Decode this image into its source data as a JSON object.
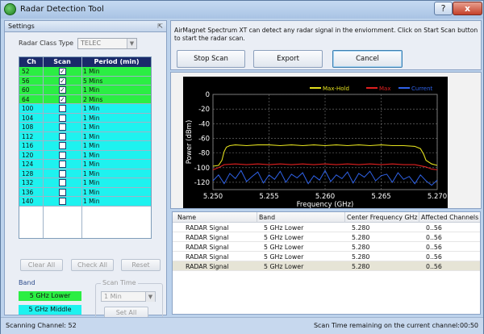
{
  "window": {
    "title": "Radar Detection Tool",
    "help_label": "?",
    "close_label": "x"
  },
  "settings": {
    "header": "Settings",
    "radar_class_label": "Radar Class Type",
    "radar_class_value": "TELEC",
    "table_headers": {
      "ch": "Ch",
      "scan": "Scan",
      "period": "Period (min)"
    },
    "channels": [
      {
        "ch": "52",
        "checked": true,
        "period": "1 Min",
        "band": "lower"
      },
      {
        "ch": "56",
        "checked": true,
        "period": "5 Mins",
        "band": "lower"
      },
      {
        "ch": "60",
        "checked": true,
        "period": "1 Min",
        "band": "lower"
      },
      {
        "ch": "64",
        "checked": true,
        "period": "2 Mins",
        "band": "lower"
      },
      {
        "ch": "100",
        "checked": false,
        "period": "1 Min",
        "band": "middle"
      },
      {
        "ch": "104",
        "checked": false,
        "period": "1 Min",
        "band": "middle"
      },
      {
        "ch": "108",
        "checked": false,
        "period": "1 Min",
        "band": "middle"
      },
      {
        "ch": "112",
        "checked": false,
        "period": "1 Min",
        "band": "middle"
      },
      {
        "ch": "116",
        "checked": false,
        "period": "1 Min",
        "band": "middle"
      },
      {
        "ch": "120",
        "checked": false,
        "period": "1 Min",
        "band": "middle"
      },
      {
        "ch": "124",
        "checked": false,
        "period": "1 Min",
        "band": "middle"
      },
      {
        "ch": "128",
        "checked": false,
        "period": "1 Min",
        "band": "middle"
      },
      {
        "ch": "132",
        "checked": false,
        "period": "1 Min",
        "band": "middle"
      },
      {
        "ch": "136",
        "checked": false,
        "period": "1 Min",
        "band": "middle"
      },
      {
        "ch": "140",
        "checked": false,
        "period": "1 Min",
        "band": "middle"
      }
    ],
    "clear_all_label": "Clear All",
    "check_all_label": "Check All",
    "reset_label": "Reset",
    "band_label": "Band",
    "band_lower_label": "5 GHz Lower",
    "band_middle_label": "5 GHz Middle",
    "band_lower_color": "#2bee43",
    "band_middle_color": "#1ef2ef",
    "scan_time_label": "Scan Time",
    "scan_time_value": "1 Min",
    "set_all_label": "Set All"
  },
  "top": {
    "info_text": "AirMagnet Spectrum XT can detect any radar signal in the enviornment. Click on Start Scan button to start the radar scan.",
    "stop_scan_label": "Stop Scan",
    "export_label": "Export",
    "cancel_label": "Cancel"
  },
  "chart_data": {
    "type": "line",
    "title": "",
    "xlabel": "Frequency (GHz)",
    "ylabel": "Power (dBm)",
    "xlim": [
      5.25,
      5.27
    ],
    "ylim": [
      -130,
      0
    ],
    "x_ticks": [
      "5.250",
      "5.255",
      "5.260",
      "5.265",
      "5.270"
    ],
    "y_ticks": [
      "0",
      "-20",
      "-40",
      "-60",
      "-80",
      "-100",
      "-120"
    ],
    "legend_position": "top-right",
    "background": "#000000",
    "series": [
      {
        "name": "Max-Hold",
        "color": "#e3e01e",
        "x": [
          5.25,
          5.2505,
          5.2508,
          5.251,
          5.2512,
          5.2515,
          5.252,
          5.253,
          5.254,
          5.255,
          5.256,
          5.257,
          5.258,
          5.259,
          5.26,
          5.261,
          5.262,
          5.263,
          5.264,
          5.265,
          5.266,
          5.267,
          5.268,
          5.2685,
          5.2688,
          5.269,
          5.2695,
          5.27
        ],
        "y": [
          -98,
          -97,
          -90,
          -78,
          -72,
          -70,
          -69,
          -70,
          -69,
          -69,
          -70,
          -69,
          -70,
          -69,
          -70,
          -69,
          -70,
          -69,
          -70,
          -69,
          -70,
          -70,
          -71,
          -74,
          -82,
          -90,
          -95,
          -97
        ]
      },
      {
        "name": "Max",
        "color": "#e02020",
        "x": [
          5.25,
          5.2505,
          5.251,
          5.252,
          5.253,
          5.254,
          5.255,
          5.256,
          5.257,
          5.258,
          5.259,
          5.26,
          5.261,
          5.262,
          5.263,
          5.264,
          5.265,
          5.266,
          5.267,
          5.268,
          5.269,
          5.2695,
          5.27
        ],
        "y": [
          -103,
          -100,
          -96,
          -95,
          -96,
          -95,
          -96,
          -95,
          -96,
          -95,
          -96,
          -95,
          -96,
          -95,
          -96,
          -95,
          -96,
          -95,
          -96,
          -96,
          -99,
          -102,
          -103
        ]
      },
      {
        "name": "Current",
        "color": "#2f62e8",
        "x": [
          5.25,
          5.2505,
          5.251,
          5.2515,
          5.252,
          5.2525,
          5.253,
          5.2535,
          5.254,
          5.2545,
          5.255,
          5.2555,
          5.256,
          5.2565,
          5.257,
          5.2575,
          5.258,
          5.2585,
          5.259,
          5.2595,
          5.26,
          5.2605,
          5.261,
          5.2615,
          5.262,
          5.2625,
          5.263,
          5.2635,
          5.264,
          5.2645,
          5.265,
          5.2655,
          5.266,
          5.2665,
          5.267,
          5.2675,
          5.268,
          5.2685,
          5.269,
          5.2695,
          5.27
        ],
        "y": [
          -118,
          -110,
          -122,
          -108,
          -115,
          -104,
          -119,
          -112,
          -106,
          -121,
          -110,
          -116,
          -105,
          -120,
          -109,
          -114,
          -107,
          -122,
          -111,
          -117,
          -104,
          -119,
          -110,
          -115,
          -106,
          -121,
          -108,
          -113,
          -105,
          -118,
          -111,
          -109,
          -120,
          -107,
          -116,
          -112,
          -122,
          -110,
          -118,
          -124,
          -117
        ]
      }
    ]
  },
  "results": {
    "headers": [
      "Name",
      "Band",
      "Center Frequency GHz",
      "Affected Channels"
    ],
    "rows": [
      [
        "RADAR Signal",
        "5 GHz Lower",
        "5.280",
        "0..56"
      ],
      [
        "RADAR Signal",
        "5 GHz Lower",
        "5.280",
        "0..56"
      ],
      [
        "RADAR Signal",
        "5 GHz Lower",
        "5.280",
        "0..56"
      ],
      [
        "RADAR Signal",
        "5 GHz Lower",
        "5.280",
        "0..56"
      ],
      [
        "RADAR Signal",
        "5 GHz Lower",
        "5.280",
        "0..56"
      ]
    ]
  },
  "status": {
    "left": "Scanning Channel: 52",
    "right": "Scan Time remaining on the current channel:00:50"
  }
}
